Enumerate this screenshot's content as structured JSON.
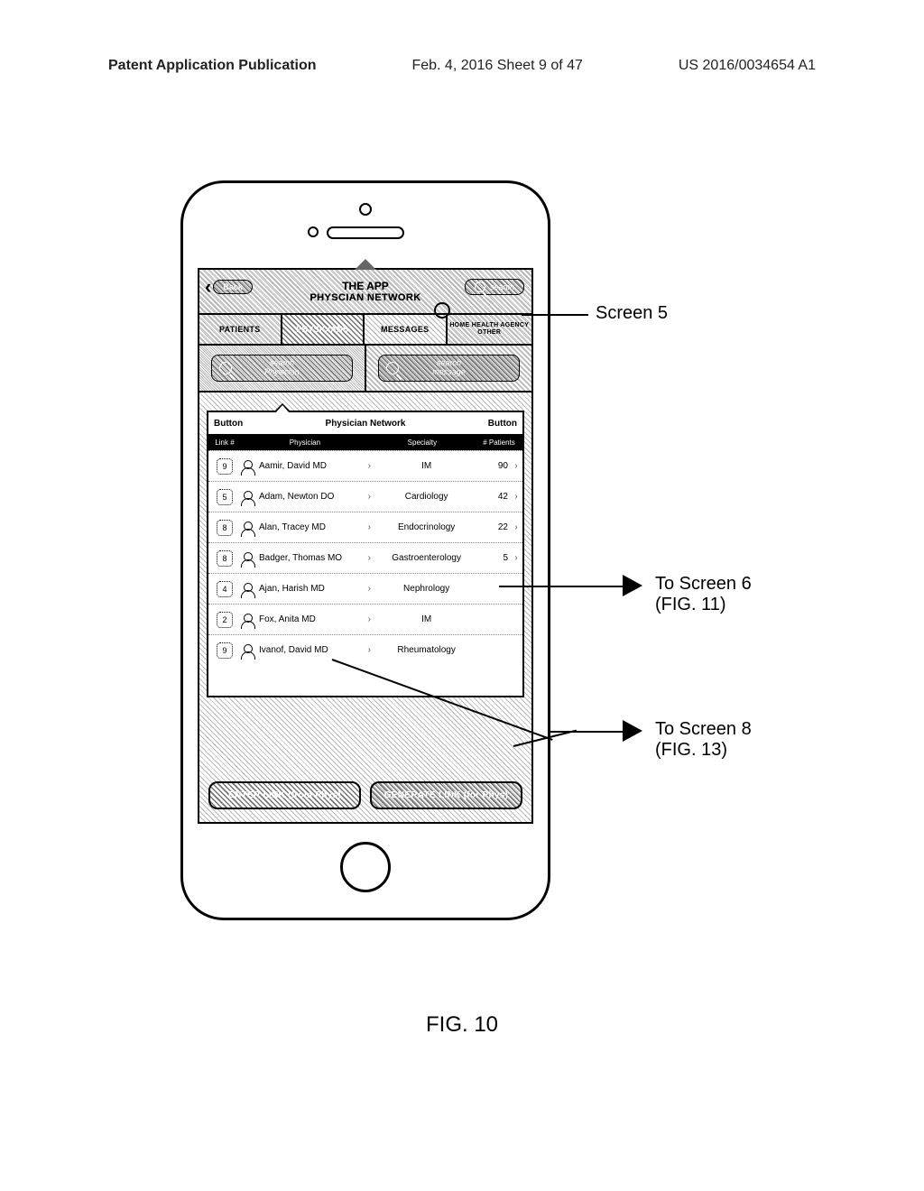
{
  "page_header": {
    "left": "Patent Application Publication",
    "mid": "Feb. 4, 2016  Sheet 9 of 47",
    "right": "US 2016/0034654 A1"
  },
  "app_title_line1": "THE APP",
  "app_title_line2": "PHYSCIAN NETWORK",
  "back_label": "Back",
  "top_search_placeholder": "search",
  "tabs": [
    "PATIENTS",
    "PHYSICIANS",
    "MESSAGES",
    "HOME HEALTH AGENCY OTHER"
  ],
  "active_tab_index": 1,
  "search_physician_label": "search\nPhysician",
  "search_message_label": "search\nmessage",
  "panel": {
    "left_label": "Button",
    "title": "Physician Network",
    "right_label": "Button",
    "cols": {
      "link": "Link #",
      "physician": "Physician",
      "specialty": "Specialty",
      "patients": "# Patients"
    },
    "rows": [
      {
        "link": "9",
        "name": "Aamir, David MD",
        "specialty": "IM",
        "patients": "90"
      },
      {
        "link": "5",
        "name": "Adam, Newton DO",
        "specialty": "Cardiology",
        "patients": "42"
      },
      {
        "link": "8",
        "name": "Alan, Tracey MD",
        "specialty": "Endocrinology",
        "patients": "22"
      },
      {
        "link": "8",
        "name": "Badger, Thomas MO",
        "specialty": "Gastroenterology",
        "patients": "5"
      },
      {
        "link": "4",
        "name": "Ajan, Harish MD",
        "specialty": "Nephrology",
        "patients": ""
      },
      {
        "link": "2",
        "name": "Fox, Anita MD",
        "specialty": "IM",
        "patients": ""
      },
      {
        "link": "9",
        "name": "Ivanof, David MD",
        "specialty": "Rheumatology",
        "patients": ""
      }
    ]
  },
  "btn_enter_link": "ENTER LINK (from Phys)",
  "btn_generate_link": "GENERATE LINK (for Phys)",
  "callouts": {
    "screen5": "Screen 5",
    "to_screen6_line1": "To Screen 6",
    "to_screen6_line2": "(FIG. 11)",
    "to_screen8_line1": "To Screen 8",
    "to_screen8_line2": "(FIG. 13)"
  },
  "figure_caption": "FIG. 10"
}
